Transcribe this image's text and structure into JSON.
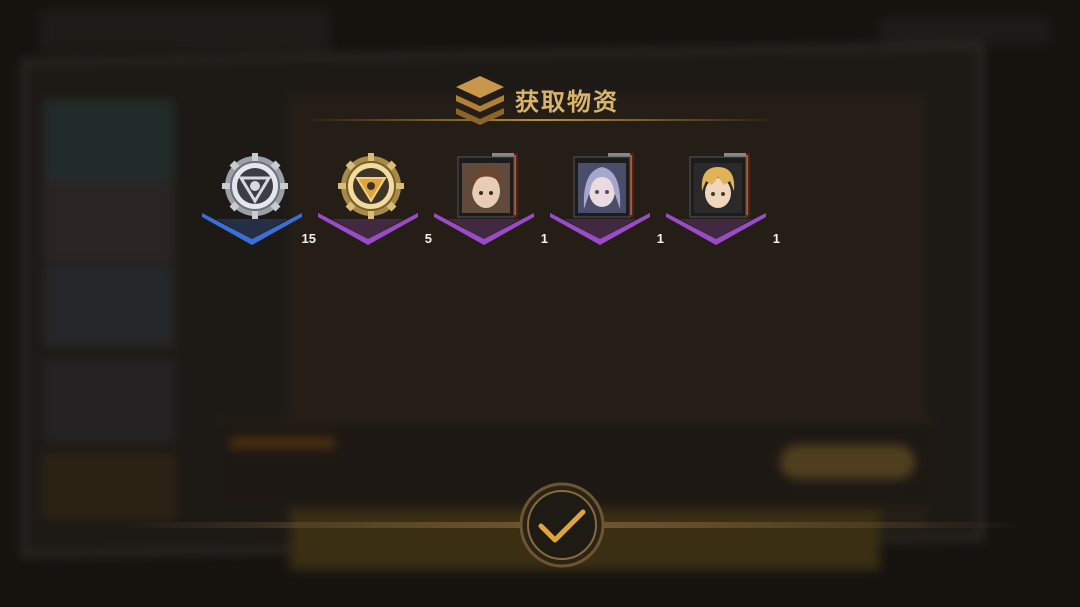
{
  "dialog": {
    "title": "获取物资",
    "confirm_icon": "checkmark-icon"
  },
  "rewards": [
    {
      "icon": "silver-medal-icon",
      "rarity": "blue",
      "rarity_color": "#3a6fd8",
      "count": "15"
    },
    {
      "icon": "gold-medal-icon",
      "rarity": "purple",
      "rarity_color": "#9a4cc8",
      "count": "5"
    },
    {
      "icon": "character-card-brown-hair-icon",
      "rarity": "purple",
      "rarity_color": "#9a4cc8",
      "count": "1"
    },
    {
      "icon": "character-card-silver-hair-icon",
      "rarity": "purple",
      "rarity_color": "#9a4cc8",
      "count": "1"
    },
    {
      "icon": "character-card-blonde-hair-icon",
      "rarity": "purple",
      "rarity_color": "#9a4cc8",
      "count": "1"
    }
  ],
  "colors": {
    "title_gold": "#d9b46a",
    "accent_gold": "#e0a43a",
    "frame_gold": "#b88c3c"
  }
}
